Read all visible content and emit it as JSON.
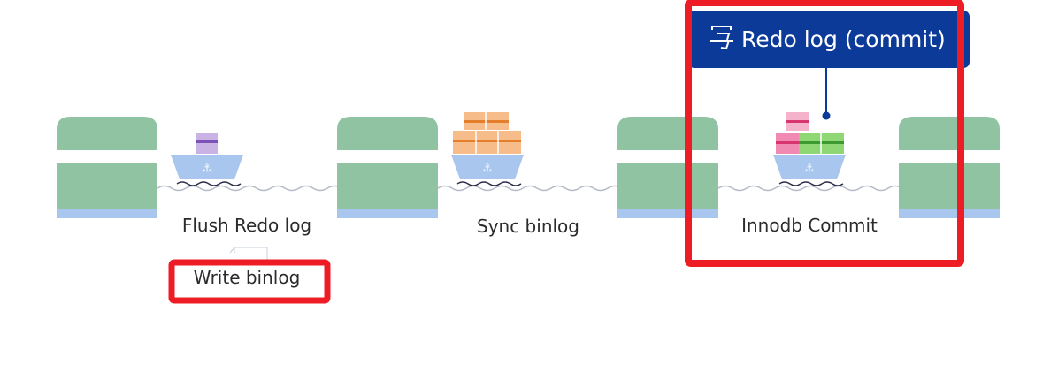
{
  "stages": [
    {
      "label": "Flush Redo log"
    },
    {
      "label": "Sync binlog"
    },
    {
      "label": "Innodb Commit"
    }
  ],
  "sub_label": "Write binlog",
  "callout": {
    "icon": "write-icon",
    "text": "Redo log (commit)"
  },
  "colors": {
    "dock_green": "#8fc3a1",
    "dock_base": "#a9c6ee",
    "hull": "#a9c6ee",
    "water": "#b5bcc8",
    "callout_bg": "#0c3a99",
    "highlight": "#ee1c25",
    "cabin_purple": "#b59ad8",
    "cargo_orange": "#f6bd8a",
    "cargo_pink": "#f08ab2",
    "cargo_green": "#8fd775"
  }
}
